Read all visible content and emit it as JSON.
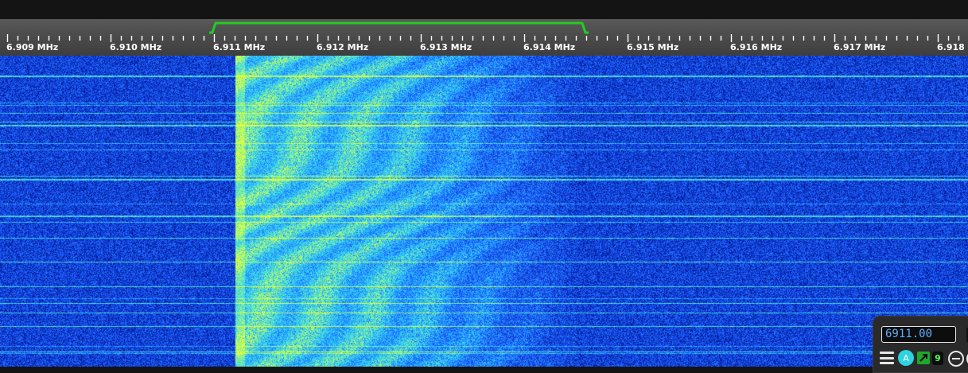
{
  "scale": {
    "start_mhz": 6.909,
    "end_mhz": 6.918,
    "unit": "MHz",
    "labels": [
      "6.909 MHz",
      "6.910 MHz",
      "6.911 MHz",
      "6.912 MHz",
      "6.913 MHz",
      "6.914 MHz",
      "6.915 MHz",
      "6.916 MHz",
      "6.917 MHz",
      "6.918 MHz"
    ],
    "passband": {
      "low_mhz": 6.911,
      "high_mhz": 6.9145
    },
    "colors": {
      "passband": "#22cc22",
      "tick": "#ffffff",
      "label": "#ffffff",
      "background": "#4a4a4a"
    }
  },
  "waterfall": {
    "signal_low_mhz": 6.9112,
    "signal_high_mhz": 6.9145,
    "palette": [
      "#00003a",
      "#001a9a",
      "#1f5cff",
      "#26c8ff",
      "#7ff2a0",
      "#e8ff30"
    ]
  },
  "panel": {
    "frequency_value": "6911.00",
    "agc_label": "A",
    "squelch_level": "9",
    "icons": [
      "menu-icon",
      "agc-icon",
      "squelch-icon",
      "zoom-out-icon",
      "zoom-icon"
    ]
  }
}
